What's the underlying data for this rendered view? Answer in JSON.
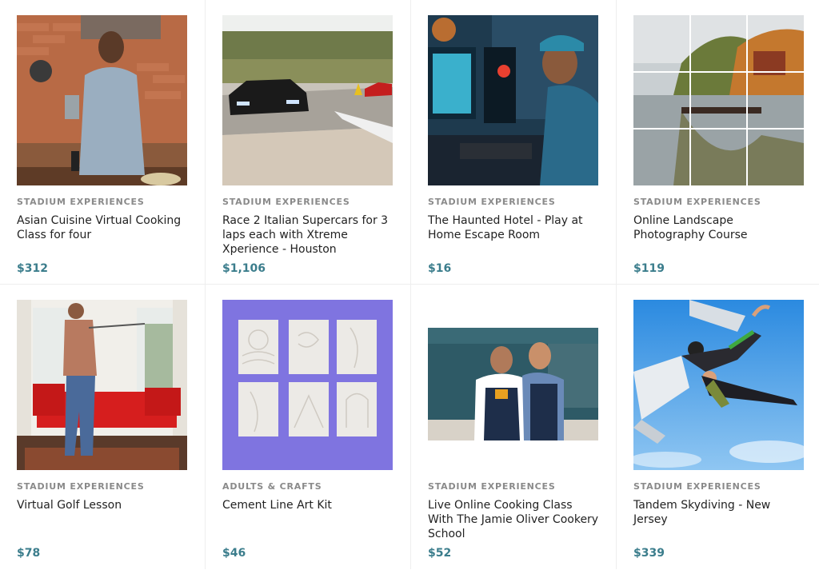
{
  "accent_color": "#3b7d8c",
  "products": [
    {
      "category": "STADIUM EXPERIENCES",
      "title": "Asian Cuisine Virtual Cooking Class for four",
      "price": "$312",
      "image": "chef-in-kitchen-photo"
    },
    {
      "category": "STADIUM EXPERIENCES",
      "title": "Race 2 Italian Supercars for 3 laps each with Xtreme Xperience - Houston",
      "price": "$1,106",
      "image": "supercar-racetrack-photo"
    },
    {
      "category": "STADIUM EXPERIENCES",
      "title": "The Haunted Hotel - Play at Home Escape Room",
      "price": "$16",
      "image": "gamer-at-computer-photo"
    },
    {
      "category": "STADIUM EXPERIENCES",
      "title": "Online Landscape Photography Course",
      "price": "$119",
      "image": "lake-landscape-grid-photo"
    },
    {
      "category": "STADIUM EXPERIENCES",
      "title": "Virtual Golf Lesson",
      "price": "$78",
      "image": "golfer-living-room-photo"
    },
    {
      "category": "ADULTS & CRAFTS",
      "title": "Cement Line Art Kit",
      "price": "$46",
      "image": "cement-tiles-photo"
    },
    {
      "category": "STADIUM EXPERIENCES",
      "title": "Live Online Cooking Class With The Jamie Oliver Cookery School",
      "price": "$52",
      "image": "two-chefs-photo"
    },
    {
      "category": "STADIUM EXPERIENCES",
      "title": "Tandem Skydiving - New Jersey",
      "price": "$339",
      "image": "skydivers-photo"
    }
  ]
}
